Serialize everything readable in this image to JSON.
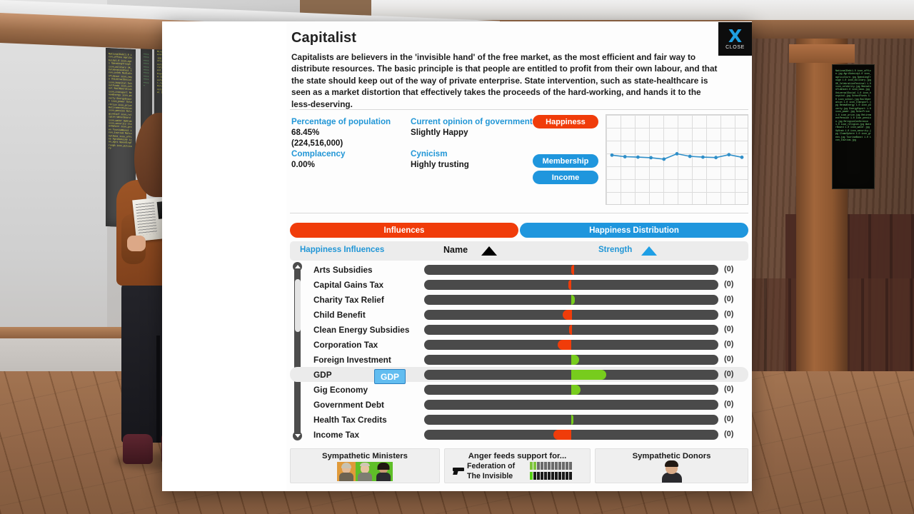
{
  "dialog": {
    "title": "Capitalist",
    "description": "Capitalists are believers in the 'invisible hand' of the free market, as the most efficient and fair way to distribute resources. The basic principle is that people are entitled to profit from their own labour, and that the state should keep out of the way of private enterprise. State intervention, such as state-healthcare is seen as a market distortion that effectively takes the proceeds of the hard-working, and hands it to the less-deserving.",
    "close_label": "CLOSE",
    "close_icon": "X"
  },
  "stats": {
    "percentage_label": "Percentage of population",
    "percentage_value": "68.45%",
    "percentage_count": "(224,516,000)",
    "complacency_label": "Complacency",
    "complacency_value": "0.00%",
    "opinion_label": "Current opinion of government",
    "opinion_value": "Slightly Happy",
    "cynicism_label": "Cynicism",
    "cynicism_value": "Highly trusting"
  },
  "graph_buttons": [
    {
      "label": "Happiness",
      "color": "#f03c0a",
      "active": true
    },
    {
      "label": "Membership",
      "color": "#1f96dd",
      "active": false
    },
    {
      "label": "Income",
      "color": "#1f96dd",
      "active": false
    }
  ],
  "chart_data": {
    "type": "line",
    "title": "Happiness",
    "xlabel": "",
    "ylabel": "",
    "grid": true,
    "legend": "none",
    "series": [
      {
        "name": "Happiness",
        "color": "#2f8fc9",
        "x": [
          0,
          1,
          2,
          3,
          4,
          5,
          6,
          7,
          8,
          9,
          10
        ],
        "values": [
          0.555,
          0.535,
          0.53,
          0.523,
          0.505,
          0.572,
          0.54,
          0.53,
          0.525,
          0.56,
          0.528
        ]
      }
    ],
    "ylim": [
      0,
      1
    ],
    "xlim": [
      0,
      10
    ]
  },
  "tabs": [
    {
      "label": "Influences",
      "active": true,
      "color": "#f03c0a"
    },
    {
      "label": "Happiness Distribution",
      "active": false,
      "color": "#1f96dd"
    }
  ],
  "list_header": {
    "section_label": "Happiness Influences",
    "name_col": "Name",
    "name_sort_icon": "triangle-up-icon",
    "strength_col": "Strength",
    "strength_sort_icon": "triangle-up-icon"
  },
  "tooltip": {
    "text": "GDP"
  },
  "influences": [
    {
      "name": "Arts Subsidies",
      "value": "(0)",
      "fill_start": 50.0,
      "fill_width": 0.9,
      "color": "#f03c0a",
      "selected": false
    },
    {
      "name": "Capital Gains Tax",
      "value": "(0)",
      "fill_start": 49.0,
      "fill_width": 1.1,
      "color": "#f03c0a",
      "selected": false
    },
    {
      "name": "Charity Tax Relief",
      "value": "(0)",
      "fill_start": 50.0,
      "fill_width": 1.2,
      "color": "#77cc1d",
      "selected": false
    },
    {
      "name": "Child Benefit",
      "value": "(0)",
      "fill_start": 47.0,
      "fill_width": 3.2,
      "color": "#f03c0a",
      "selected": false
    },
    {
      "name": "Clean Energy Subsidies",
      "value": "(0)",
      "fill_start": 49.3,
      "fill_width": 1.0,
      "color": "#f03c0a",
      "selected": false
    },
    {
      "name": "Corporation Tax",
      "value": "(0)",
      "fill_start": 45.5,
      "fill_width": 4.6,
      "color": "#f03c0a",
      "selected": false
    },
    {
      "name": "Foreign Investment",
      "value": "(0)",
      "fill_start": 50.0,
      "fill_width": 2.7,
      "color": "#77cc1d",
      "selected": false
    },
    {
      "name": "GDP",
      "value": "(0)",
      "fill_start": 50.0,
      "fill_width": 12.0,
      "color": "#77cc1d",
      "selected": true
    },
    {
      "name": "Gig Economy",
      "value": "(0)",
      "fill_start": 50.0,
      "fill_width": 3.1,
      "color": "#77cc1d",
      "selected": false
    },
    {
      "name": "Government Debt",
      "value": "(0)",
      "fill_start": 50.0,
      "fill_width": 0.0,
      "color": "#77cc1d",
      "selected": false
    },
    {
      "name": "Health Tax Credits",
      "value": "(0)",
      "fill_start": 50.0,
      "fill_width": 0.8,
      "color": "#77cc1d",
      "selected": false
    },
    {
      "name": "Income Tax",
      "value": "(0)",
      "fill_start": 44.0,
      "fill_width": 6.1,
      "color": "#f03c0a",
      "selected": false
    }
  ],
  "bottom": {
    "ministers_title": "Sympathetic Ministers",
    "anger_title": "Anger feeds support for...",
    "anger_rows": [
      {
        "label": "Federation of",
        "filled": 2,
        "total": 12,
        "color": "#7ec43a",
        "icon": null
      },
      {
        "label": "The Invisible",
        "filled": 1,
        "total": 12,
        "color": "#55d014",
        "icon": "gun-icon"
      }
    ],
    "donors_title": "Sympathetic Donors"
  }
}
